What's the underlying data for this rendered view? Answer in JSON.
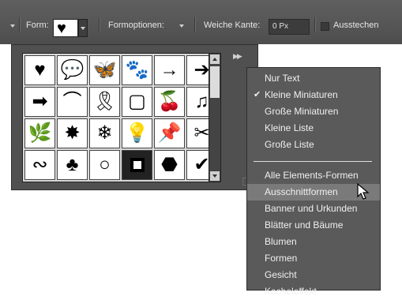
{
  "toolbar": {
    "shape_label": "Form:",
    "shape_options_label": "Formoptionen:",
    "feather_label": "Weiche Kante:",
    "feather_value": "0 Px",
    "cutout_label": "Ausstechen"
  },
  "shape_grid": {
    "cells": [
      "♥",
      "💬",
      "🦋",
      "🐾",
      "→",
      "➔",
      "➡",
      "⌒",
      "🎗",
      "▢",
      "🍒",
      "♫",
      "🌿",
      "✸",
      "❄",
      "💡",
      "📌",
      "✂",
      "∾",
      "♣",
      "○",
      "■",
      "⬣",
      "✔"
    ],
    "selected_index": 21
  },
  "menu": {
    "items": [
      {
        "label": "Nur Text",
        "checked": false
      },
      {
        "label": "Kleine Miniaturen",
        "checked": true
      },
      {
        "label": "Große Miniaturen",
        "checked": false
      },
      {
        "label": "Kleine Liste",
        "checked": false
      },
      {
        "label": "Große Liste",
        "checked": false
      },
      {
        "label": "Alle Elements-Formen",
        "checked": false
      },
      {
        "label": "Ausschnittformen",
        "checked": false,
        "active": true
      },
      {
        "label": "Banner und Urkunden",
        "checked": false
      },
      {
        "label": "Blätter und Bäume",
        "checked": false
      },
      {
        "label": "Blumen",
        "checked": false
      },
      {
        "label": "Formen",
        "checked": false
      },
      {
        "label": "Gesicht",
        "checked": false
      },
      {
        "label": "Kacheleffekt",
        "checked": false
      }
    ],
    "check_glyph": "✔"
  },
  "colors": {
    "toolbar_bg": "#555555",
    "menu_bg": "#5a5a5a",
    "menu_active": "#7a7a7a",
    "text": "#f0f0f0"
  }
}
